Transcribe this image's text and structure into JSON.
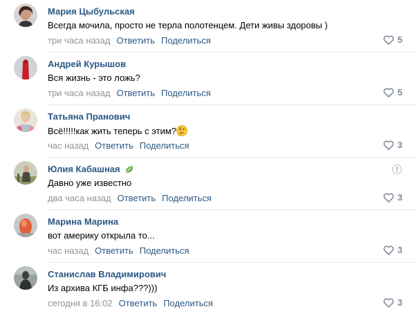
{
  "comments": [
    {
      "author": "Мария Цыбульская",
      "text": "Всегда мочила, просто не терла полотенцем. Дети живы здоровы )",
      "time": "три часа назад",
      "reply": "Ответить",
      "share": "Поделиться",
      "likes": "5"
    },
    {
      "author": "Андрей Курышов",
      "text": "Вся жизнь - это ложь?",
      "time": "три часа назад",
      "reply": "Ответить",
      "share": "Поделиться",
      "likes": "5"
    },
    {
      "author": "Татьяна Пранович",
      "text": "Всё!!!!!как жить теперь с этим?",
      "time": "час назад",
      "reply": "Ответить",
      "share": "Поделиться",
      "likes": "3"
    },
    {
      "author": "Юлия Кабашная",
      "text": "Давно уже известно",
      "time": "два часа назад",
      "reply": "Ответить",
      "share": "Поделиться",
      "likes": "3"
    },
    {
      "author": "Марина Марина",
      "text": "вот америку открыла то...",
      "time": "час назад",
      "reply": "Ответить",
      "share": "Поделиться",
      "likes": "3"
    },
    {
      "author": "Станислав Владимирович",
      "text": "Из архива КГБ инфа???)))",
      "time": "сегодня в 16:02",
      "reply": "Ответить",
      "share": "Поделиться",
      "likes": "3"
    }
  ],
  "icons": {
    "like": "heart-icon",
    "report": "alert-circle-icon",
    "badge": "leaf-icon",
    "emoji": "thinking-face-emoji"
  },
  "colors": {
    "author": "#2a5885",
    "meta": "#939393",
    "likes": "#828a99",
    "divider": "#e7e8ec"
  }
}
